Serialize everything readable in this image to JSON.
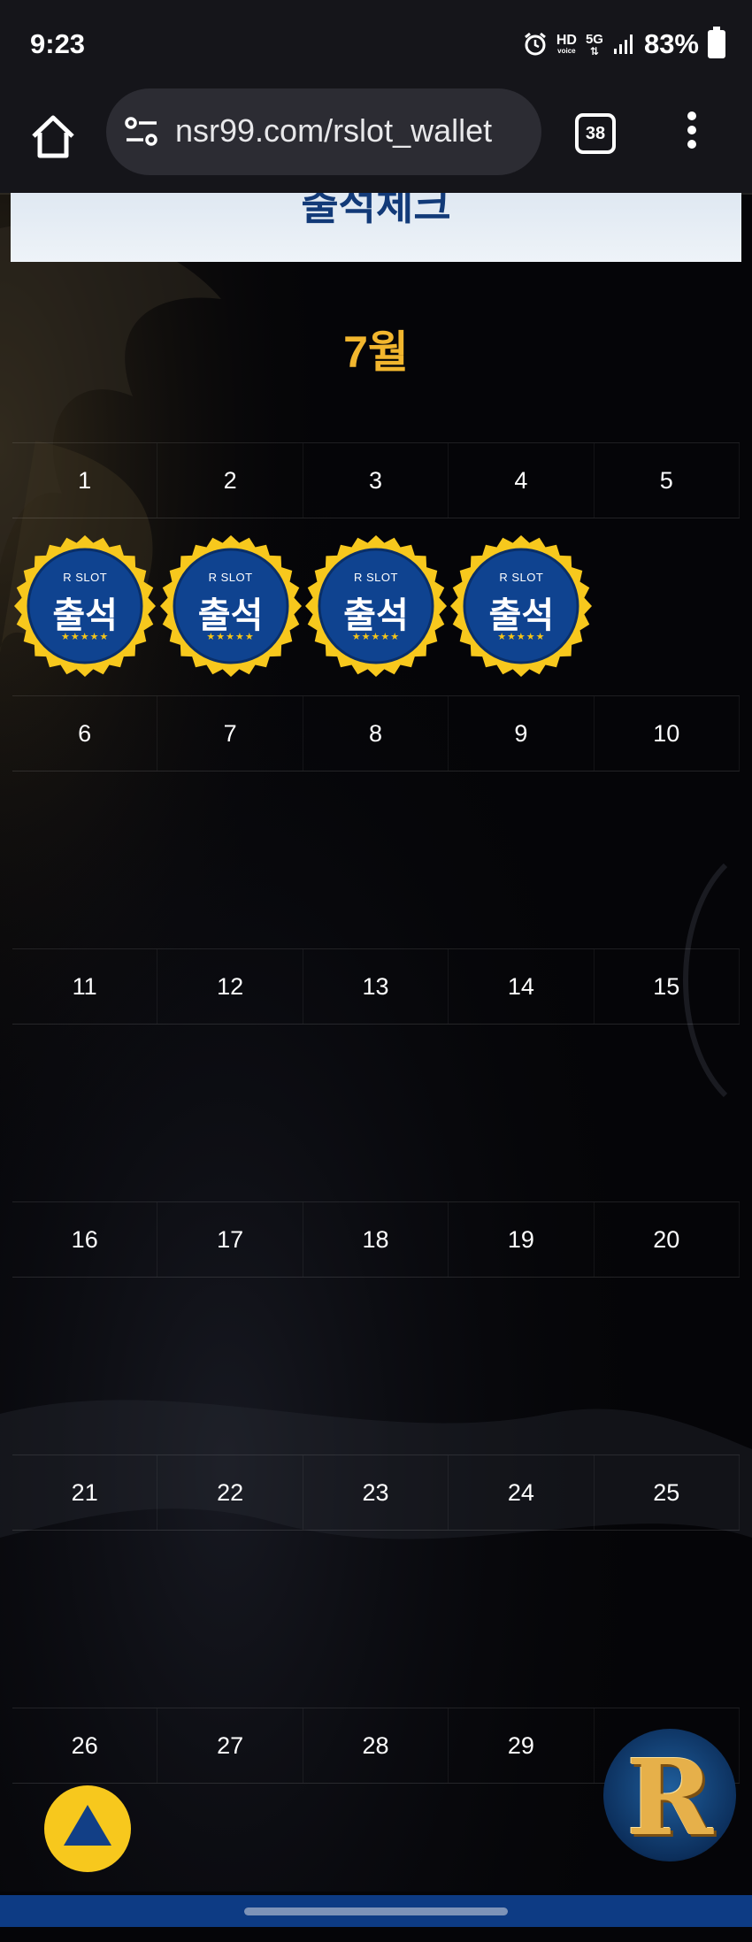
{
  "status_bar": {
    "time": "9:23",
    "hd_label": "HD",
    "voice_label": "voice",
    "network_label": "5G",
    "battery": "83%"
  },
  "browser": {
    "url": "nsr99.com/rslot_wallet",
    "tab_count": "38"
  },
  "banner": {
    "title": "출석체크"
  },
  "calendar": {
    "month_label": "7월",
    "weeks": [
      [
        "1",
        "2",
        "3",
        "4",
        "5"
      ],
      [
        "6",
        "7",
        "8",
        "9",
        "10"
      ],
      [
        "11",
        "12",
        "13",
        "14",
        "15"
      ],
      [
        "16",
        "17",
        "18",
        "19",
        "20"
      ],
      [
        "21",
        "22",
        "23",
        "24",
        "25"
      ],
      [
        "26",
        "27",
        "28",
        "29",
        ""
      ]
    ],
    "attended_days": [
      "1",
      "2",
      "3",
      "4"
    ],
    "stamp": {
      "brand": "R SLOT",
      "label": "출석",
      "stars": "★★★★★"
    }
  },
  "floating": {
    "logo_letter": "R"
  },
  "colors": {
    "accent_gold": "#f2b62e",
    "stamp_blue": "#0f4390",
    "stamp_rim": "#f7c81d",
    "banner_text": "#123a78"
  }
}
